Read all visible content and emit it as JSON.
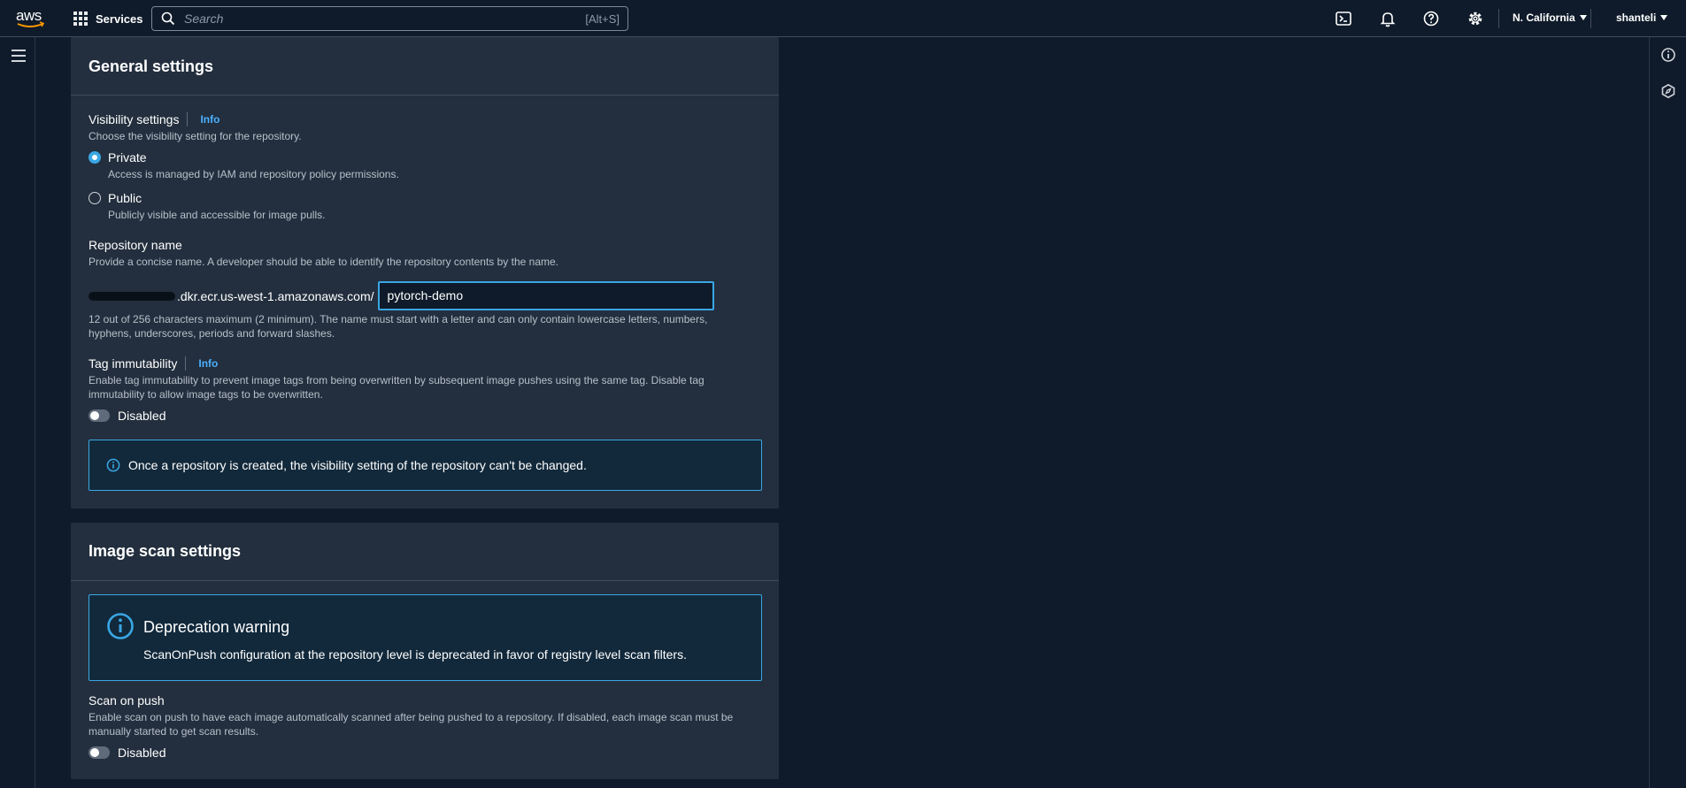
{
  "topnav": {
    "logo_text": "aws",
    "services_label": "Services",
    "search_placeholder": "Search",
    "search_shortcut": "[Alt+S]",
    "region": "N. California",
    "user": "shanteli",
    "icons": [
      "cloudshell-icon",
      "bell-icon",
      "help-icon",
      "settings-icon"
    ]
  },
  "general_settings": {
    "title": "General settings",
    "visibility": {
      "label": "Visibility settings",
      "info": "Info",
      "description": "Choose the visibility setting for the repository.",
      "options": [
        {
          "label": "Private",
          "description": "Access is managed by IAM and repository policy permissions.",
          "selected": true
        },
        {
          "label": "Public",
          "description": "Publicly visible and accessible for image pulls.",
          "selected": false
        }
      ]
    },
    "repository_name": {
      "label": "Repository name",
      "description": "Provide a concise name. A developer should be able to identify the repository contents by the name.",
      "prefix": ".dkr.ecr.us-west-1.amazonaws.com/",
      "value": "pytorch-demo",
      "hint_line1": "12 out of 256 characters maximum (2 minimum). The name must start with a letter and can only contain lowercase letters, numbers,",
      "hint_line2": "hyphens, underscores, periods and forward slashes."
    },
    "tag_immutability": {
      "label": "Tag immutability",
      "info": "Info",
      "description_line1": "Enable tag immutability to prevent image tags from being overwritten by subsequent image pushes using the same tag. Disable tag",
      "description_line2": "immutability to allow image tags to be overwritten.",
      "toggle_label": "Disabled",
      "enabled": false
    },
    "alert": "Once a repository is created, the visibility setting of the repository can't be changed."
  },
  "image_scan_settings": {
    "title": "Image scan settings",
    "warning": {
      "title": "Deprecation warning",
      "text": "ScanOnPush configuration at the repository level is deprecated in favor of registry level scan filters."
    },
    "scan_on_push": {
      "label": "Scan on push",
      "description_line1": "Enable scan on push to have each image automatically scanned after being pushed to a repository. If disabled, each image scan must be",
      "description_line2": "manually started to get scan results.",
      "toggle_label": "Disabled",
      "enabled": false
    }
  },
  "colors": {
    "background": "#0f1b2a",
    "panel": "#232f3e",
    "accent": "#39a7e4",
    "link": "#4cb0ff"
  }
}
